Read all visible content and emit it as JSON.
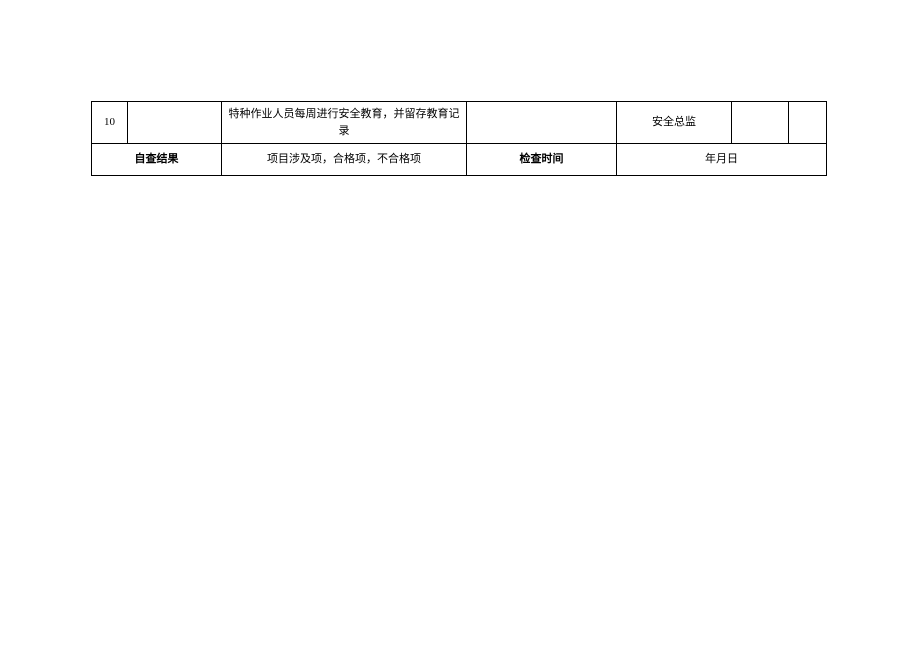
{
  "row1": {
    "number": "10",
    "col2": "",
    "description": "特种作业人员每周进行安全教育，并留存教育记录",
    "col4": "",
    "role": "安全总监",
    "col6": "",
    "col7": ""
  },
  "row2": {
    "label1": "自查结果",
    "value1": "项目涉及项，合格项，不合格项",
    "label2": "检查时间",
    "value2": "年月日"
  }
}
